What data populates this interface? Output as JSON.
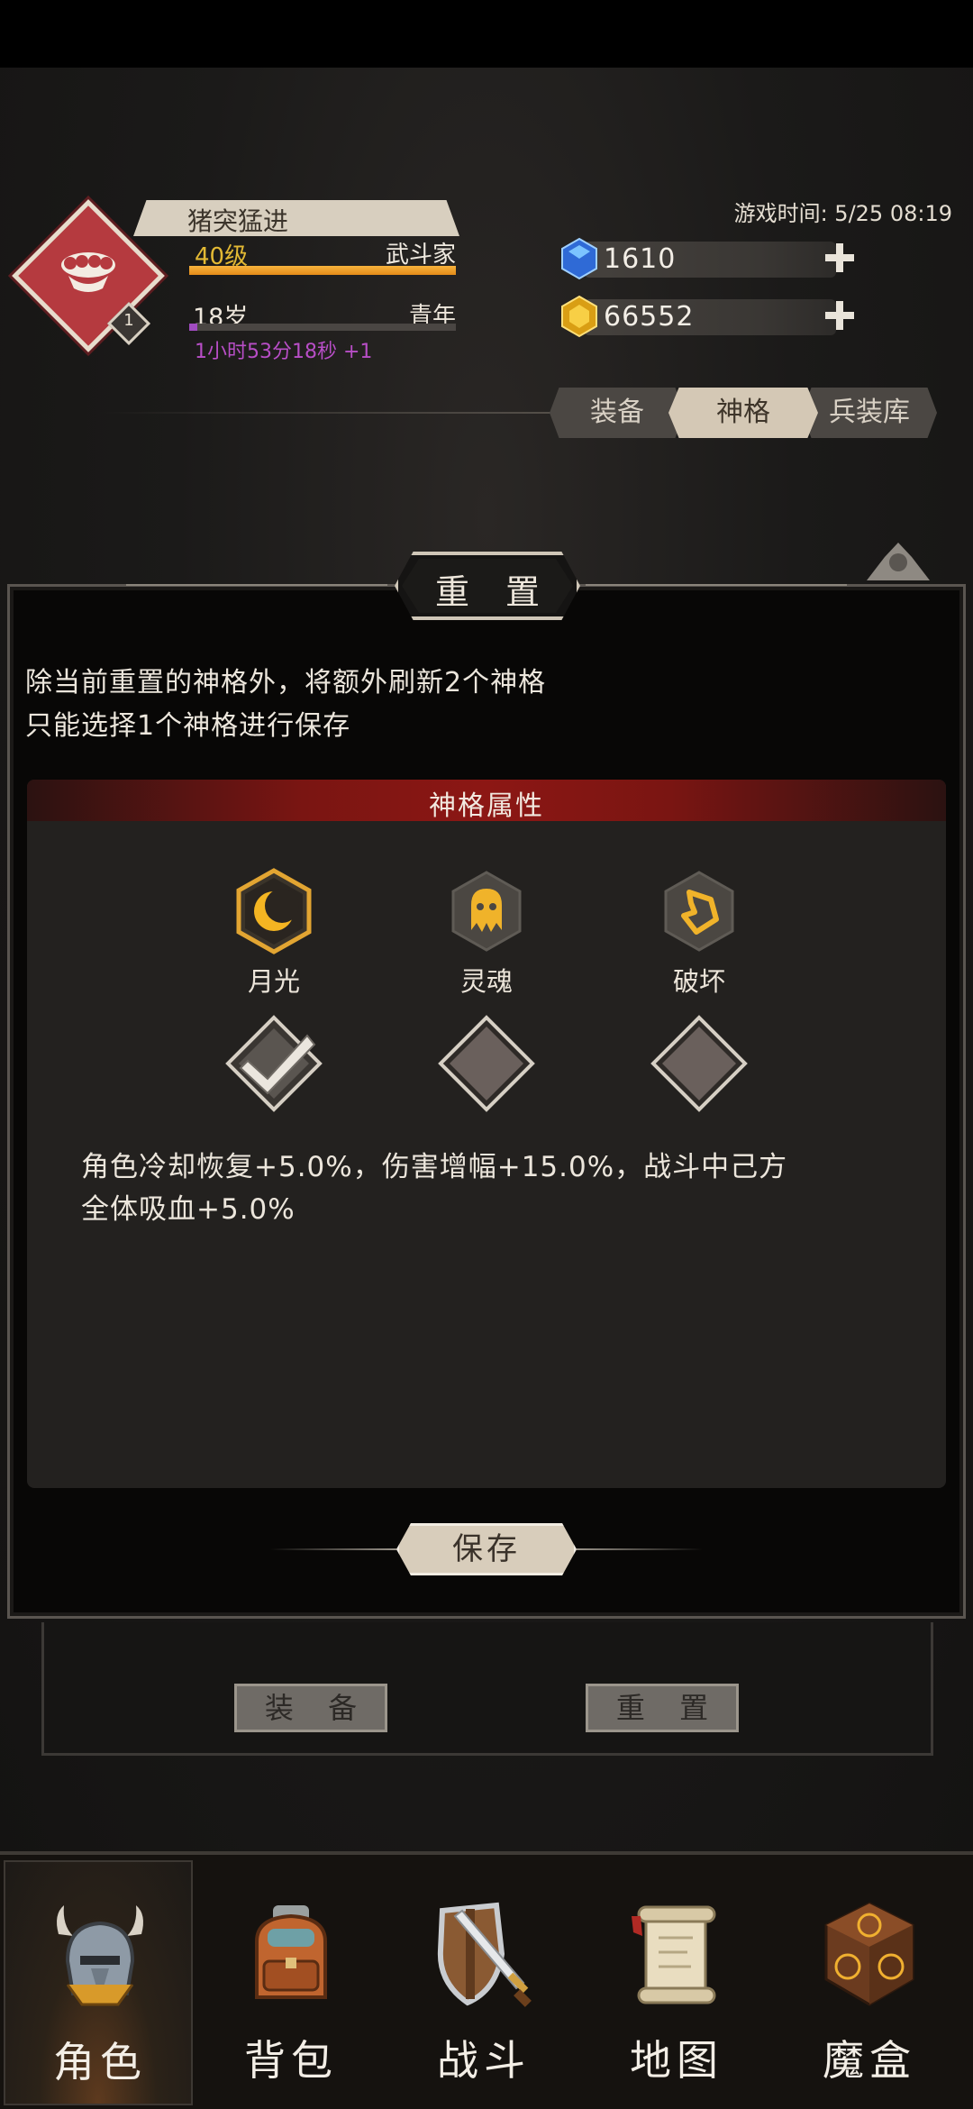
{
  "character": {
    "name": "猪突猛进",
    "level": "40级",
    "class_name": "武斗家",
    "level_progress": 1.0,
    "badge_number": "1",
    "age": "18岁",
    "age_stage": "青年",
    "age_progress": 0.03,
    "timer": "1小时53分18秒 +1"
  },
  "game_time": "游戏时间: 5/25 08:19",
  "resources": [
    {
      "name": "blue-gem",
      "value": "1610",
      "color": "#3d7fe0"
    },
    {
      "name": "gold-gem",
      "value": "66552",
      "color": "#e9b51f"
    }
  ],
  "tabs": [
    {
      "label": "装备",
      "active": false
    },
    {
      "label": "神格",
      "active": true
    },
    {
      "label": "兵装库",
      "active": false
    }
  ],
  "panel": {
    "title": "重 置",
    "description_line1": "除当前重置的神格外，将额外刷新2个神格",
    "description_line2": "只能选择1个神格进行保存",
    "section_title": "神格属性",
    "divinities": [
      {
        "label": "月光",
        "icon": "moon-icon",
        "selected": true
      },
      {
        "label": "灵魂",
        "icon": "ghost-icon",
        "selected": false
      },
      {
        "label": "破坏",
        "icon": "shatter-icon",
        "selected": false
      }
    ],
    "effect_line1": "角色冷却恢复+5.0%，伤害增幅+15.0%，战斗中己方",
    "effect_line2": "全体吸血+5.0%",
    "save_label": "保存"
  },
  "under_buttons": {
    "equip": "装 备",
    "reset": "重 置"
  },
  "nav": [
    {
      "label": "角色",
      "icon": "helmet-icon",
      "active": true
    },
    {
      "label": "背包",
      "icon": "backpack-icon",
      "active": false
    },
    {
      "label": "战斗",
      "icon": "sword-shield-icon",
      "active": false
    },
    {
      "label": "地图",
      "icon": "scroll-map-icon",
      "active": false
    },
    {
      "label": "魔盒",
      "icon": "magic-box-icon",
      "active": false
    }
  ],
  "colors": {
    "accent_gold": "#e3b934",
    "accent_purple": "#b84ec7",
    "section_red": "#8c1714",
    "class_red": "#b53a3f"
  }
}
